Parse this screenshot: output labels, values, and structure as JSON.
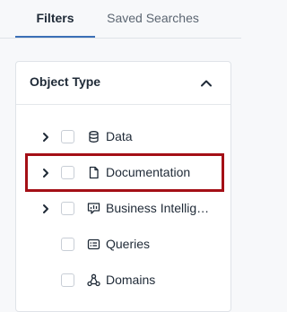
{
  "tabs": [
    {
      "label": "Filters",
      "active": true
    },
    {
      "label": "Saved Searches",
      "active": false
    }
  ],
  "panel": {
    "title": "Object Type",
    "collapse_icon": "chevron-up-icon"
  },
  "items": [
    {
      "label": "Data",
      "icon": "database-icon",
      "expandable": true,
      "checked": false
    },
    {
      "label": "Documentation",
      "icon": "document-icon",
      "expandable": true,
      "checked": false
    },
    {
      "label": "Business Intelligence",
      "icon": "business-intelligence-icon",
      "expandable": true,
      "checked": false
    },
    {
      "label": "Queries",
      "icon": "query-icon",
      "expandable": false,
      "checked": false
    },
    {
      "label": "Domains",
      "icon": "domains-icon",
      "expandable": false,
      "checked": false
    }
  ],
  "colors": {
    "accent": "#3b6fb6",
    "highlight": "#a40f16"
  }
}
